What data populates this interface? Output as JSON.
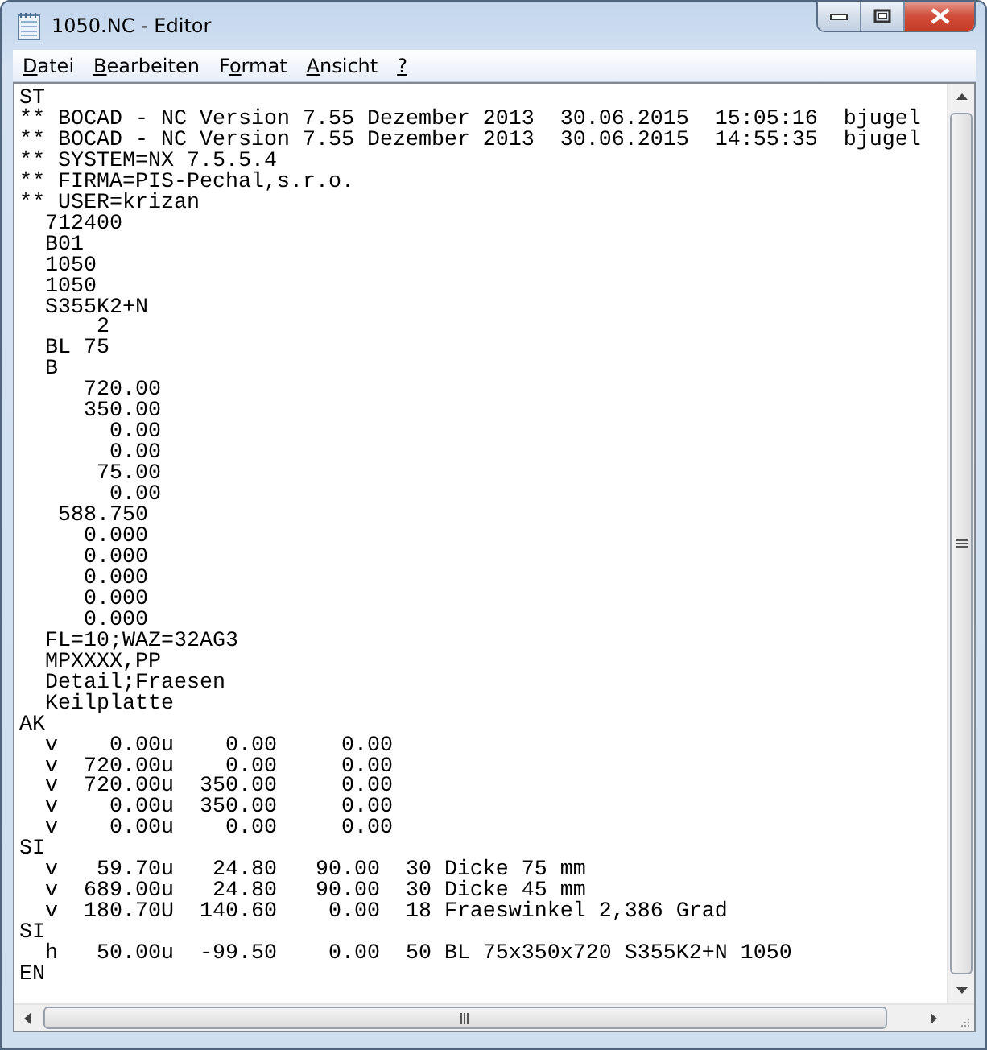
{
  "window": {
    "title": "1050.NC - Editor"
  },
  "menu": [
    {
      "key": "D",
      "post": "atei"
    },
    {
      "key": "B",
      "post": "earbeiten"
    },
    {
      "pre": "F",
      "key": "o",
      "post": "rmat"
    },
    {
      "key": "A",
      "post": "nsicht"
    },
    {
      "key": "?"
    }
  ],
  "document": {
    "lines": [
      "ST",
      "** BOCAD - NC Version 7.55 Dezember 2013  30.06.2015  15:05:16  bjugel",
      "** BOCAD - NC Version 7.55 Dezember 2013  30.06.2015  14:55:35  bjugel",
      "** SYSTEM=NX 7.5.5.4",
      "** FIRMA=PIS-Pechal,s.r.o.",
      "** USER=krizan",
      "  712400",
      "  B01",
      "  1050",
      "  1050",
      "  S355K2+N",
      "      2",
      "  BL 75",
      "  B",
      "     720.00",
      "     350.00",
      "       0.00",
      "       0.00",
      "      75.00",
      "       0.00",
      "   588.750",
      "     0.000",
      "     0.000",
      "     0.000",
      "     0.000",
      "     0.000",
      "  FL=10;WAZ=32AG3",
      "  MPXXXX,PP",
      "  Detail;Fraesen",
      "  Keilplatte",
      "AK",
      "  v    0.00u    0.00     0.00",
      "  v  720.00u    0.00     0.00",
      "  v  720.00u  350.00     0.00",
      "  v    0.00u  350.00     0.00",
      "  v    0.00u    0.00     0.00",
      "SI",
      "  v   59.70u   24.80   90.00  30 Dicke 75 mm",
      "  v  689.00u   24.80   90.00  30 Dicke 45 mm",
      "  v  180.70U  140.60    0.00  18 Fraeswinkel 2,386 Grad",
      "SI",
      "  h   50.00u  -99.50    0.00  50 BL 75x350x720 S355K2+N 1050",
      "EN"
    ]
  }
}
